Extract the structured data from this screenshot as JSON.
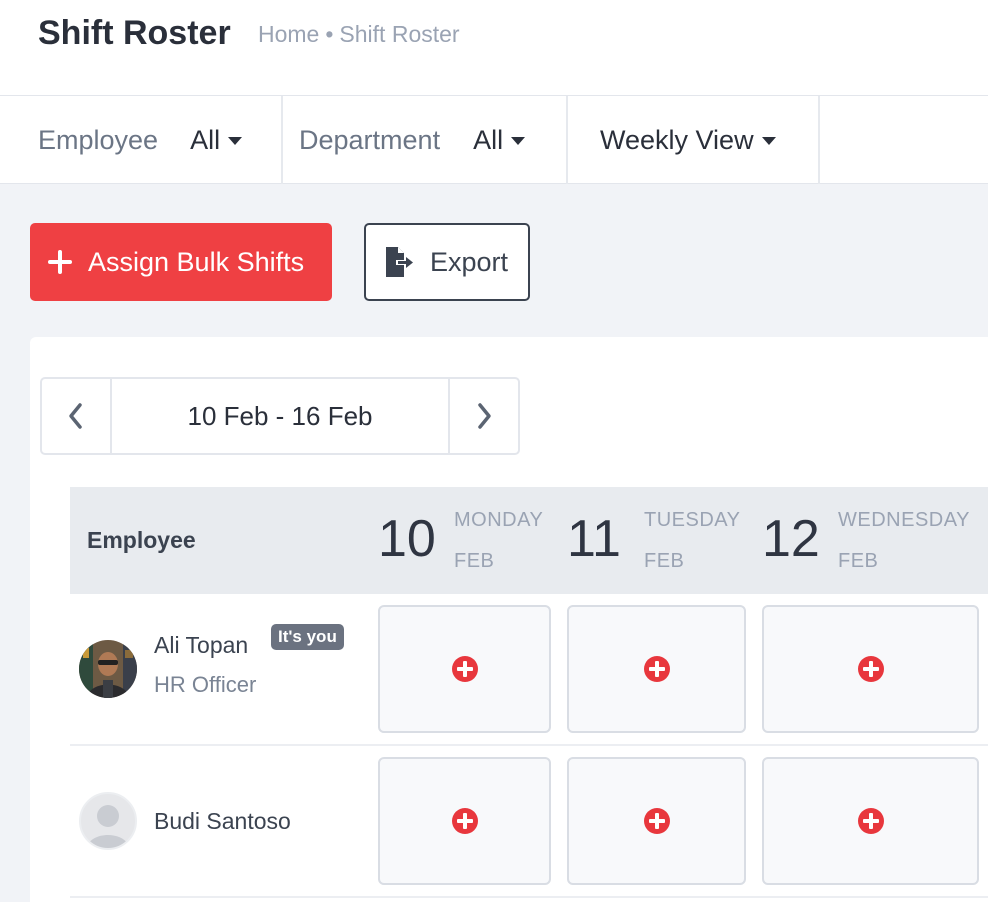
{
  "header": {
    "title": "Shift Roster",
    "breadcrumb": {
      "home": "Home",
      "separator": "•",
      "current": "Shift Roster"
    }
  },
  "filters": {
    "employee": {
      "label": "Employee",
      "value": "All"
    },
    "department": {
      "label": "Department",
      "value": "All"
    },
    "view": {
      "value": "Weekly View"
    }
  },
  "actions": {
    "assign_label": "Assign Bulk Shifts",
    "export_label": "Export"
  },
  "week_nav": {
    "range": "10 Feb - 16 Feb"
  },
  "grid": {
    "employee_column_label": "Employee",
    "days": [
      {
        "num": "10",
        "name": "MONDAY",
        "month": "FEB"
      },
      {
        "num": "11",
        "name": "TUESDAY",
        "month": "FEB"
      },
      {
        "num": "12",
        "name": "WEDNESDAY",
        "month": "FEB"
      }
    ],
    "rows": [
      {
        "name": "Ali Topan",
        "badge": "It's you",
        "role": "HR Officer",
        "avatar": "photo"
      },
      {
        "name": "Budi Santoso",
        "role": "",
        "avatar": "default-user"
      }
    ]
  },
  "colors": {
    "accent_red": "#ef4043",
    "add_icon_red": "#e8373d",
    "header_bg": "#e8ebef",
    "page_bg": "#f1f3f7"
  },
  "icons": {
    "plus": "plus-icon",
    "export": "file-export-icon",
    "prev": "chevron-left-icon",
    "next": "chevron-right-icon",
    "caret": "caret-down-icon",
    "add_shift": "add-circle-icon"
  }
}
